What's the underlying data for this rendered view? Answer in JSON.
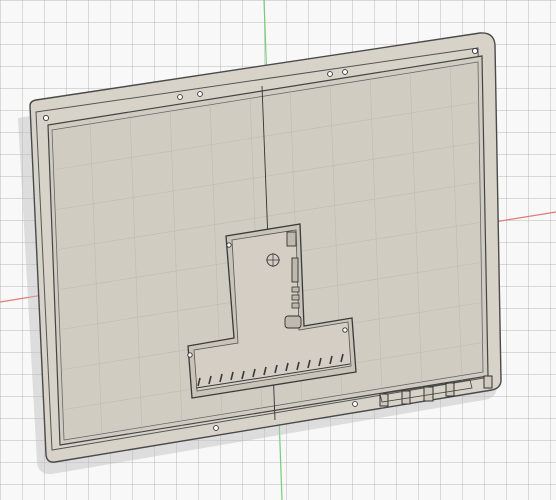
{
  "app": "CAD 3D viewport",
  "colors": {
    "background": "#f8f8f8",
    "grid_line": "#c9c9c9",
    "x_axis": "#e07a7a",
    "y_axis": "#6fcf7a",
    "body_fill": "#d8d3c9",
    "body_stroke": "#4a4a4a",
    "shadow": "#bdbdbd"
  },
  "scene": {
    "object": "enclosure-back-panel",
    "features": [
      "outer-rim",
      "inner-pocket",
      "t-cutout",
      "port-slots",
      "mounting-holes",
      "vent-ribs",
      "edge-notches"
    ]
  }
}
